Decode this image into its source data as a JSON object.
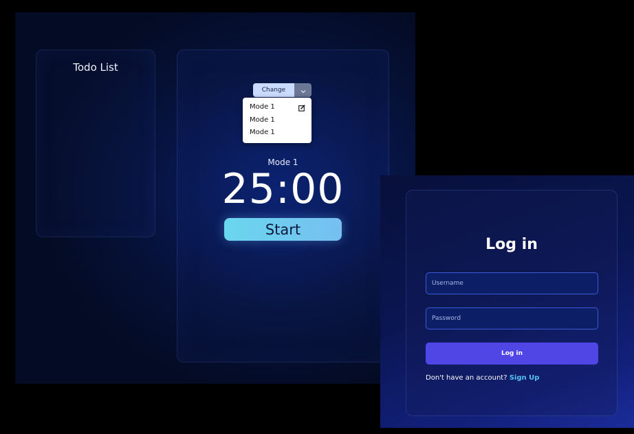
{
  "pomodoro": {
    "todo": {
      "title": "Todo List"
    },
    "mode_switcher": {
      "change_label": "Change",
      "toggle_icon": "chevron-down-icon",
      "options": [
        {
          "label": "Mode 1",
          "icon": "edit-icon"
        },
        {
          "label": "Mode 1"
        },
        {
          "label": "Mode 1"
        }
      ]
    },
    "current_mode": "Mode 1",
    "timer": "25:00",
    "start_label": "Start"
  },
  "login": {
    "title": "Log in",
    "username_placeholder": "Username",
    "password_placeholder": "Password",
    "submit_label": "Log in",
    "signup_prompt": "Don't have an account?",
    "signup_link": "Sign Up"
  },
  "colors": {
    "start_gradient_from": "#6ad6ee",
    "start_gradient_to": "#76bff0",
    "login_button": "#4f46e5",
    "signup_link": "#55c2f5",
    "input_border": "#3d5ad6"
  }
}
